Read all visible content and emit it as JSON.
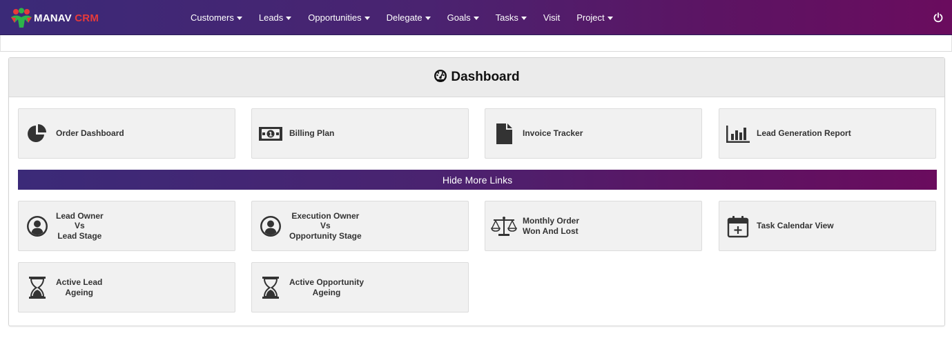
{
  "brand": {
    "name_part1": "MANAV",
    "name_part2": " CRM",
    "accent_color": "#e83a3a"
  },
  "nav": {
    "items": [
      {
        "label": "Customers",
        "dropdown": true
      },
      {
        "label": "Leads",
        "dropdown": true
      },
      {
        "label": "Opportunities",
        "dropdown": true
      },
      {
        "label": "Delegate",
        "dropdown": true
      },
      {
        "label": "Goals",
        "dropdown": true
      },
      {
        "label": "Tasks",
        "dropdown": true
      },
      {
        "label": "Visit",
        "dropdown": false
      },
      {
        "label": "Project",
        "dropdown": true
      }
    ],
    "power_icon": "power-icon"
  },
  "dashboard": {
    "title": "Dashboard",
    "title_icon": "tachometer-icon",
    "top_tiles": [
      {
        "label": "Order Dashboard",
        "icon": "pie-chart-icon"
      },
      {
        "label": "Billing Plan",
        "icon": "money-bill-icon"
      },
      {
        "label": "Invoice Tracker",
        "icon": "file-icon"
      },
      {
        "label": "Lead Generation Report",
        "icon": "bar-chart-icon"
      }
    ],
    "more_links_label": "Hide More Links",
    "more_tiles": [
      {
        "lines": [
          "Lead Owner",
          "Vs",
          "Lead Stage"
        ],
        "icon": "user-circle-icon"
      },
      {
        "lines": [
          "Execution Owner",
          "Vs",
          "Opportunity Stage"
        ],
        "icon": "user-circle-icon"
      },
      {
        "lines": [
          "Monthly Order",
          "Won And Lost"
        ],
        "icon": "balance-scale-icon"
      },
      {
        "lines": [
          "Task Calendar View"
        ],
        "icon": "calendar-plus-icon"
      },
      {
        "lines": [
          "Active Lead",
          "Ageing"
        ],
        "icon": "hourglass-icon"
      },
      {
        "lines": [
          "Active Opportunity",
          "Ageing"
        ],
        "icon": "hourglass-icon"
      }
    ]
  },
  "colors": {
    "nav_start": "#3b2a78",
    "nav_end": "#6a0c5e",
    "tile_bg": "#f1f1f1",
    "icon": "#333333"
  }
}
